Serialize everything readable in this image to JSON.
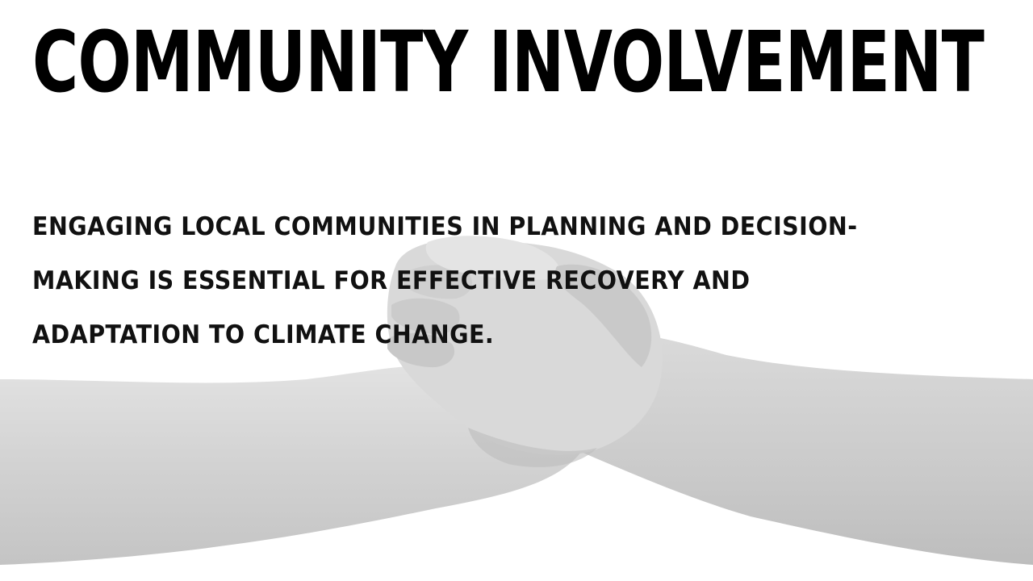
{
  "slide": {
    "title": "COMMUNITY INVOLVEMENT",
    "body": "ENGAGING LOCAL COMMUNITIES IN PLANNING AND DECISION-MAKING IS ESSENTIAL FOR EFFECTIVE RECOVERY AND ADAPTATION TO CLIMATE CHANGE.",
    "background_image": "clasped-hands-image"
  },
  "colors": {
    "background": "#ffffff",
    "text": "#000000",
    "image_tone": "#d6d6d6"
  }
}
